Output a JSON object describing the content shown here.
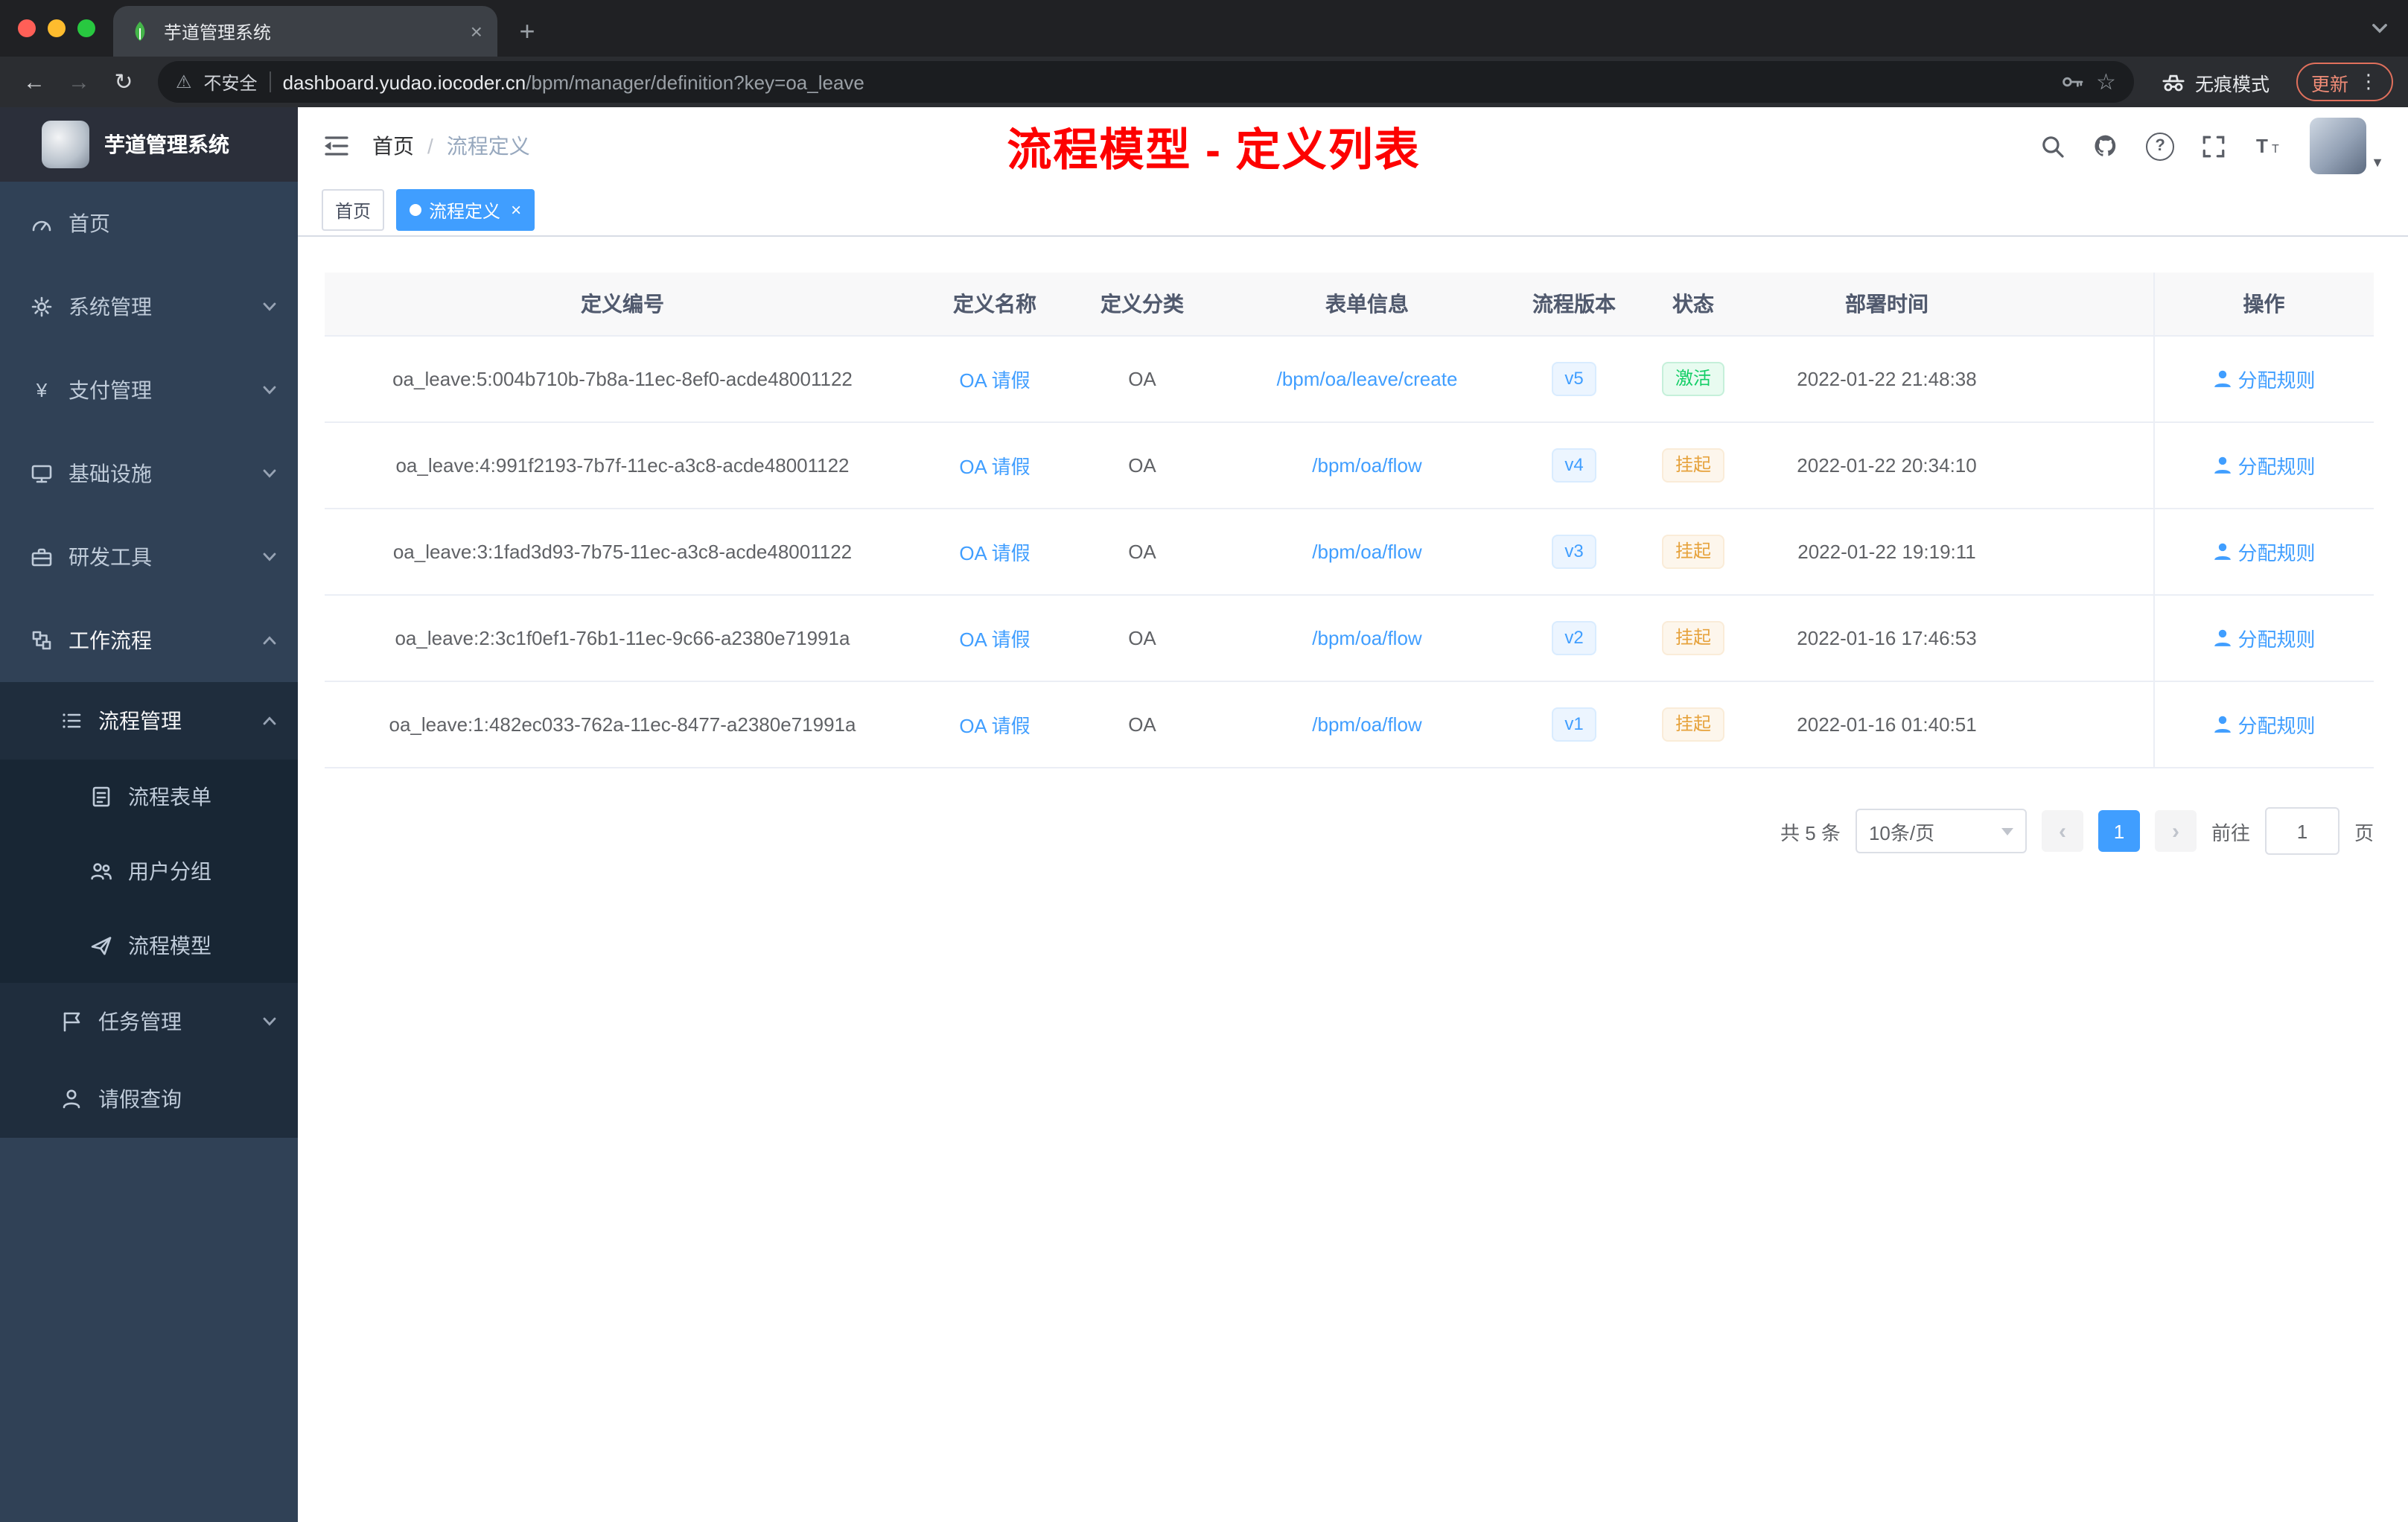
{
  "browser": {
    "tab": {
      "title": "芋道管理系统",
      "favicon": "yudao-leaf-icon"
    },
    "toolbar": {
      "security_label": "不安全",
      "url_host": "dashboard.yudao.iocoder.cn",
      "url_path": "/bpm/manager/definition?key=oa_leave",
      "incognito_label": "无痕模式",
      "update_label": "更新"
    }
  },
  "glyphs": {
    "close": "×",
    "plus": "+",
    "kebab": "⋮",
    "star": "☆",
    "warning": "⚠",
    "back": "←",
    "forward": "→",
    "reload": "↻",
    "caret_down": "▼"
  },
  "sidebar": {
    "logo_title": "芋道管理系统",
    "items": [
      {
        "label": "首页",
        "icon": "dashboard-icon",
        "level": 1
      },
      {
        "label": "系统管理",
        "icon": "gear-icon",
        "level": 1,
        "chevron": "down"
      },
      {
        "label": "支付管理",
        "icon": "yen-icon",
        "level": 1,
        "chevron": "down"
      },
      {
        "label": "基础设施",
        "icon": "monitor-icon",
        "level": 1,
        "chevron": "down"
      },
      {
        "label": "研发工具",
        "icon": "toolbox-icon",
        "level": 1,
        "chevron": "down"
      },
      {
        "label": "工作流程",
        "icon": "workflow-icon",
        "level": 1,
        "chevron": "up",
        "expanded": true
      },
      {
        "label": "流程管理",
        "icon": "list-icon",
        "level": 2,
        "chevron": "up",
        "expanded": true
      },
      {
        "label": "流程表单",
        "icon": "form-icon",
        "level": 3
      },
      {
        "label": "用户分组",
        "icon": "user-group-icon",
        "level": 3
      },
      {
        "label": "流程模型",
        "icon": "send-icon",
        "level": 3
      },
      {
        "label": "任务管理",
        "icon": "task-icon",
        "level": 2,
        "chevron": "down"
      },
      {
        "label": "请假查询",
        "icon": "user-icon",
        "level": 2
      }
    ]
  },
  "header": {
    "breadcrumb": {
      "home": "首页",
      "separator": "/",
      "current": "流程定义"
    },
    "annotation": "流程模型 - 定义列表",
    "icons": [
      "search-icon",
      "github-icon",
      "question-icon",
      "fullscreen-icon",
      "font-size-icon",
      "avatar"
    ]
  },
  "tags": {
    "items": [
      {
        "label": "首页",
        "active": false
      },
      {
        "label": "流程定义",
        "active": true
      }
    ]
  },
  "table": {
    "columns": [
      "定义编号",
      "定义名称",
      "定义分类",
      "表单信息",
      "流程版本",
      "状态",
      "部署时间",
      "操作"
    ],
    "rows": [
      {
        "id": "oa_leave:5:004b710b-7b8a-11ec-8ef0-acde48001122",
        "name": "OA 请假",
        "category": "OA",
        "form": "/bpm/oa/leave/create",
        "version": "v5",
        "status": "激活",
        "status_type": "success",
        "deploy_time": "2022-01-22 21:48:38",
        "action": "分配规则"
      },
      {
        "id": "oa_leave:4:991f2193-7b7f-11ec-a3c8-acde48001122",
        "name": "OA 请假",
        "category": "OA",
        "form": "/bpm/oa/flow",
        "version": "v4",
        "status": "挂起",
        "status_type": "warning",
        "deploy_time": "2022-01-22 20:34:10",
        "action": "分配规则"
      },
      {
        "id": "oa_leave:3:1fad3d93-7b75-11ec-a3c8-acde48001122",
        "name": "OA 请假",
        "category": "OA",
        "form": "/bpm/oa/flow",
        "version": "v3",
        "status": "挂起",
        "status_type": "warning",
        "deploy_time": "2022-01-22 19:19:11",
        "action": "分配规则"
      },
      {
        "id": "oa_leave:2:3c1f0ef1-76b1-11ec-9c66-a2380e71991a",
        "name": "OA 请假",
        "category": "OA",
        "form": "/bpm/oa/flow",
        "version": "v2",
        "status": "挂起",
        "status_type": "warning",
        "deploy_time": "2022-01-16 17:46:53",
        "action": "分配规则"
      },
      {
        "id": "oa_leave:1:482ec033-762a-11ec-8477-a2380e71991a",
        "name": "OA 请假",
        "category": "OA",
        "form": "/bpm/oa/flow",
        "version": "v1",
        "status": "挂起",
        "status_type": "warning",
        "deploy_time": "2022-01-16 01:40:51",
        "action": "分配规则"
      }
    ]
  },
  "pagination": {
    "total": "共 5 条",
    "page_size": "10条/页",
    "prev": "‹",
    "page": "1",
    "next": "›",
    "goto_label": "前往",
    "goto_value": "1",
    "unit_label": "页"
  },
  "colors": {
    "accent": "#409eff",
    "status_active": "#13ce66",
    "status_suspended": "#e6a23c",
    "annotation_red": "#fd0100",
    "sidebar_bg": "#304156",
    "submenu_bg": "#1f2d3d"
  }
}
